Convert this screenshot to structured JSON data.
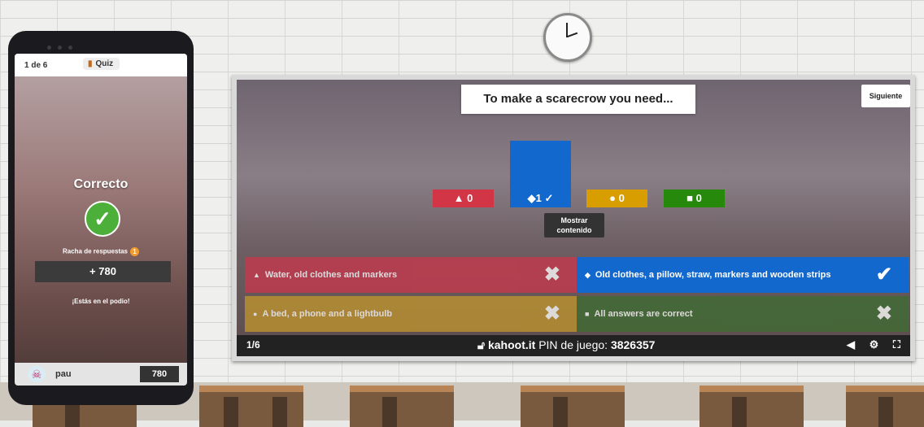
{
  "phone": {
    "question_count": "1 de 6",
    "quiz_label": "Quiz",
    "result": "Correcto",
    "result_icon": "check-icon",
    "streak_label": "Racha de respuestas",
    "streak_value": "1",
    "points_gained": "+ 780",
    "podium_text": "¡Estás en el podio!",
    "player_name": "pau",
    "player_score": "780"
  },
  "board": {
    "question": "To make a scarecrow you need...",
    "next_button": "Siguiente",
    "show_content": "Mostrar contenido",
    "results": [
      {
        "shape": "▲",
        "count": "0",
        "correct": false,
        "color": "#d13546",
        "fill": 0
      },
      {
        "shape": "◆",
        "count": "1",
        "correct": true,
        "color": "#1368ce",
        "fill": 1
      },
      {
        "shape": "●",
        "count": "0",
        "correct": false,
        "color": "#d89e00",
        "fill": 0
      },
      {
        "shape": "■",
        "count": "0",
        "correct": false,
        "color": "#26890c",
        "fill": 0
      }
    ],
    "answers": [
      {
        "shape": "▲",
        "text": "Water, old clothes and markers",
        "correct": false,
        "color": "#c7384c"
      },
      {
        "shape": "◆",
        "text": "Old clothes, a pillow, straw, markers and wooden strips",
        "correct": true,
        "color": "#1368ce"
      },
      {
        "shape": "●",
        "text": "A bed, a phone and a lightbulb",
        "correct": false,
        "color": "#bf942f"
      },
      {
        "shape": "■",
        "text": "All answers are correct",
        "correct": false,
        "color": "#3f6d32"
      }
    ],
    "footer": {
      "page": "1/6",
      "site": "kahoot.it",
      "pin_label": "PIN de juego:",
      "pin": "3826357"
    }
  }
}
